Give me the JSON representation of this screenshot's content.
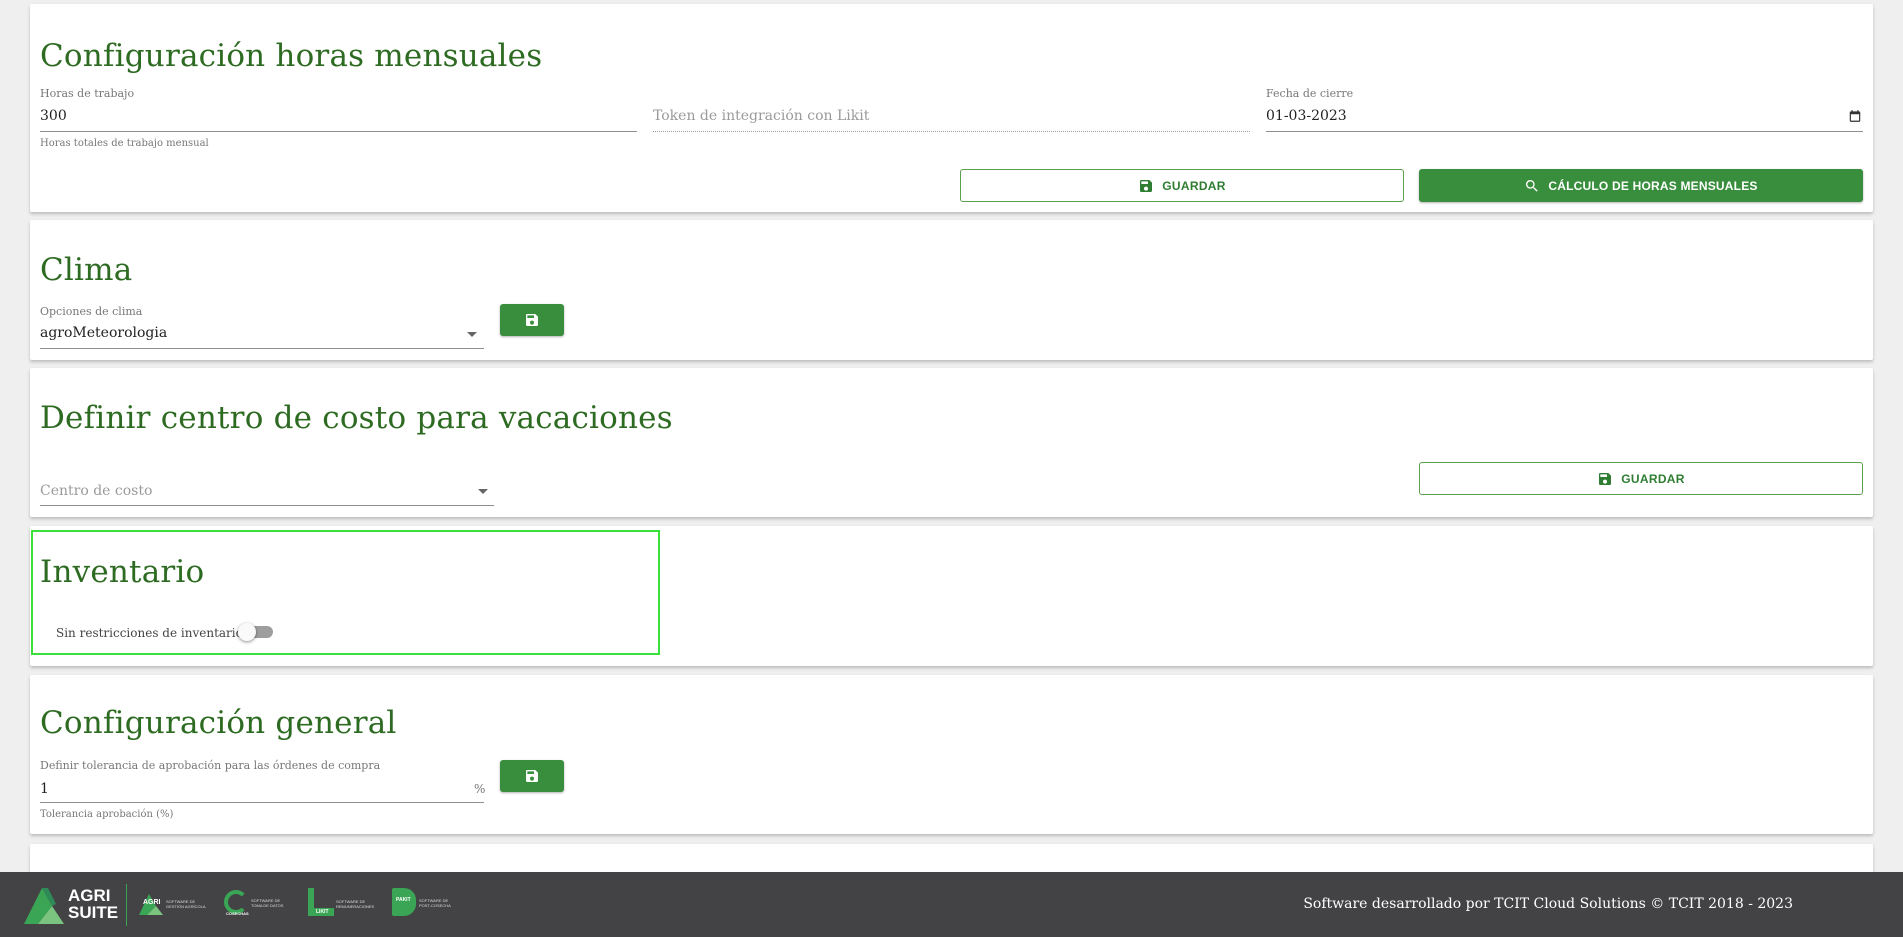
{
  "hours_section": {
    "title": "Configuración horas mensuales",
    "work_hours_label": "Horas de trabajo",
    "work_hours_value": "300",
    "work_hours_help": "Horas totales de trabajo mensual",
    "token_placeholder": "Token de integración con Likit",
    "close_date_label": "Fecha de cierre",
    "close_date_value": "01-03-2023",
    "save_label": "GUARDAR",
    "calc_label": "CÁLCULO DE HORAS MENSUALES"
  },
  "weather_section": {
    "title": "Clima",
    "options_label": "Opciones de clima",
    "selected": "agroMeteorologia"
  },
  "vacation_section": {
    "title": "Definir centro de costo para vacaciones",
    "cost_center_placeholder": "Centro de costo",
    "save_label": "GUARDAR"
  },
  "inventory_section": {
    "title": "Inventario",
    "toggle_label": "Sin restricciones de inventario",
    "toggle_on": false
  },
  "general_section": {
    "title": "Configuración general",
    "tolerance_label": "Definir tolerancia de aprobación para las órdenes de compra",
    "tolerance_value": "1",
    "tolerance_suffix": "%",
    "tolerance_help": "Tolerancia aprobación (%)"
  },
  "footer": {
    "logo_main_line1": "AGRI",
    "logo_main_line2": "SUITE",
    "logo_agri": "AGRI",
    "logo_agri_sub": "SOFTWARE DE GESTIÓN AGRÍCOLA",
    "logo_cosechas": "COSECHAS",
    "logo_cosechas_sub": "SOFTWARE DE TOMA DE DATOS",
    "logo_likit": "LIKIT",
    "logo_likit_sub": "SOFTWARE DE REMUNERACIONES",
    "logo_packit": "PAKIT",
    "logo_packit_sub": "SOFTWARE DE POST-COSECHA",
    "credits": "Software desarrollado por TCIT Cloud Solutions © TCIT 2018 - 2023"
  },
  "colors": {
    "brand_green": "#388e3c",
    "title_green": "#2e6b22",
    "highlight": "#39e039",
    "footer_bg": "#434345"
  }
}
